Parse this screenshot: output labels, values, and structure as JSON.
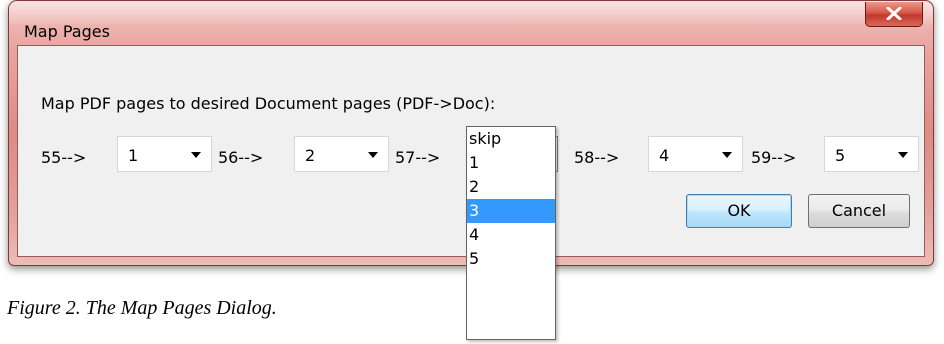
{
  "window": {
    "title": "Map Pages"
  },
  "dialog": {
    "instruction": "Map PDF pages to desired Document pages (PDF->Doc):",
    "mappings": [
      {
        "label": "55-->",
        "value": "1"
      },
      {
        "label": "56-->",
        "value": "2"
      },
      {
        "label": "57-->",
        "value": "3"
      },
      {
        "label": "58-->",
        "value": "4"
      },
      {
        "label": "59-->",
        "value": "5"
      }
    ],
    "open_dropdown": {
      "options": [
        "skip",
        "1",
        "2",
        "3",
        "4",
        "5"
      ],
      "selected": "3"
    },
    "buttons": {
      "ok": "OK",
      "cancel": "Cancel"
    }
  },
  "caption": "Figure 2. The Map Pages Dialog.",
  "colors": {
    "selection": "#3399ff",
    "close_button": "#c2382b"
  },
  "icons": {
    "close": "close-icon",
    "dropdown": "chevron-down-icon"
  }
}
